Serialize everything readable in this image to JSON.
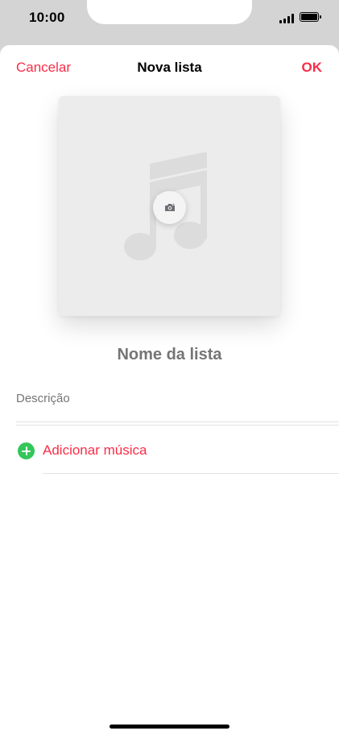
{
  "status_bar": {
    "time": "10:00"
  },
  "nav": {
    "cancel": "Cancelar",
    "title": "Nova lista",
    "ok": "OK"
  },
  "artwork": {
    "placeholder_icon": "music-note-icon",
    "camera_icon": "camera-icon"
  },
  "form": {
    "name_placeholder": "Nome da lista",
    "description_placeholder": "Descrição"
  },
  "add_music": {
    "label": "Adicionar música",
    "icon": "plus-circle-icon"
  },
  "colors": {
    "accent": "#fa2d48",
    "add_icon": "#33c759",
    "background": "#ffffff"
  }
}
